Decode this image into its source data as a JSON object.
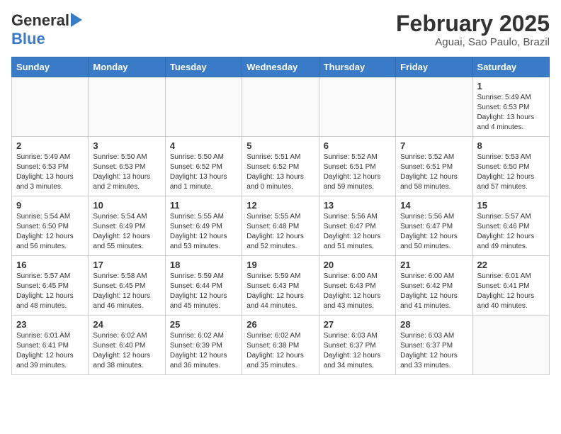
{
  "header": {
    "logo_general": "General",
    "logo_blue": "Blue",
    "month_title": "February 2025",
    "location": "Aguai, Sao Paulo, Brazil"
  },
  "weekdays": [
    "Sunday",
    "Monday",
    "Tuesday",
    "Wednesday",
    "Thursday",
    "Friday",
    "Saturday"
  ],
  "weeks": [
    [
      {
        "day": "",
        "info": ""
      },
      {
        "day": "",
        "info": ""
      },
      {
        "day": "",
        "info": ""
      },
      {
        "day": "",
        "info": ""
      },
      {
        "day": "",
        "info": ""
      },
      {
        "day": "",
        "info": ""
      },
      {
        "day": "1",
        "info": "Sunrise: 5:49 AM\nSunset: 6:53 PM\nDaylight: 13 hours\nand 4 minutes."
      }
    ],
    [
      {
        "day": "2",
        "info": "Sunrise: 5:49 AM\nSunset: 6:53 PM\nDaylight: 13 hours\nand 3 minutes."
      },
      {
        "day": "3",
        "info": "Sunrise: 5:50 AM\nSunset: 6:53 PM\nDaylight: 13 hours\nand 2 minutes."
      },
      {
        "day": "4",
        "info": "Sunrise: 5:50 AM\nSunset: 6:52 PM\nDaylight: 13 hours\nand 1 minute."
      },
      {
        "day": "5",
        "info": "Sunrise: 5:51 AM\nSunset: 6:52 PM\nDaylight: 13 hours\nand 0 minutes."
      },
      {
        "day": "6",
        "info": "Sunrise: 5:52 AM\nSunset: 6:51 PM\nDaylight: 12 hours\nand 59 minutes."
      },
      {
        "day": "7",
        "info": "Sunrise: 5:52 AM\nSunset: 6:51 PM\nDaylight: 12 hours\nand 58 minutes."
      },
      {
        "day": "8",
        "info": "Sunrise: 5:53 AM\nSunset: 6:50 PM\nDaylight: 12 hours\nand 57 minutes."
      }
    ],
    [
      {
        "day": "9",
        "info": "Sunrise: 5:54 AM\nSunset: 6:50 PM\nDaylight: 12 hours\nand 56 minutes."
      },
      {
        "day": "10",
        "info": "Sunrise: 5:54 AM\nSunset: 6:49 PM\nDaylight: 12 hours\nand 55 minutes."
      },
      {
        "day": "11",
        "info": "Sunrise: 5:55 AM\nSunset: 6:49 PM\nDaylight: 12 hours\nand 53 minutes."
      },
      {
        "day": "12",
        "info": "Sunrise: 5:55 AM\nSunset: 6:48 PM\nDaylight: 12 hours\nand 52 minutes."
      },
      {
        "day": "13",
        "info": "Sunrise: 5:56 AM\nSunset: 6:47 PM\nDaylight: 12 hours\nand 51 minutes."
      },
      {
        "day": "14",
        "info": "Sunrise: 5:56 AM\nSunset: 6:47 PM\nDaylight: 12 hours\nand 50 minutes."
      },
      {
        "day": "15",
        "info": "Sunrise: 5:57 AM\nSunset: 6:46 PM\nDaylight: 12 hours\nand 49 minutes."
      }
    ],
    [
      {
        "day": "16",
        "info": "Sunrise: 5:57 AM\nSunset: 6:45 PM\nDaylight: 12 hours\nand 48 minutes."
      },
      {
        "day": "17",
        "info": "Sunrise: 5:58 AM\nSunset: 6:45 PM\nDaylight: 12 hours\nand 46 minutes."
      },
      {
        "day": "18",
        "info": "Sunrise: 5:59 AM\nSunset: 6:44 PM\nDaylight: 12 hours\nand 45 minutes."
      },
      {
        "day": "19",
        "info": "Sunrise: 5:59 AM\nSunset: 6:43 PM\nDaylight: 12 hours\nand 44 minutes."
      },
      {
        "day": "20",
        "info": "Sunrise: 6:00 AM\nSunset: 6:43 PM\nDaylight: 12 hours\nand 43 minutes."
      },
      {
        "day": "21",
        "info": "Sunrise: 6:00 AM\nSunset: 6:42 PM\nDaylight: 12 hours\nand 41 minutes."
      },
      {
        "day": "22",
        "info": "Sunrise: 6:01 AM\nSunset: 6:41 PM\nDaylight: 12 hours\nand 40 minutes."
      }
    ],
    [
      {
        "day": "23",
        "info": "Sunrise: 6:01 AM\nSunset: 6:41 PM\nDaylight: 12 hours\nand 39 minutes."
      },
      {
        "day": "24",
        "info": "Sunrise: 6:02 AM\nSunset: 6:40 PM\nDaylight: 12 hours\nand 38 minutes."
      },
      {
        "day": "25",
        "info": "Sunrise: 6:02 AM\nSunset: 6:39 PM\nDaylight: 12 hours\nand 36 minutes."
      },
      {
        "day": "26",
        "info": "Sunrise: 6:02 AM\nSunset: 6:38 PM\nDaylight: 12 hours\nand 35 minutes."
      },
      {
        "day": "27",
        "info": "Sunrise: 6:03 AM\nSunset: 6:37 PM\nDaylight: 12 hours\nand 34 minutes."
      },
      {
        "day": "28",
        "info": "Sunrise: 6:03 AM\nSunset: 6:37 PM\nDaylight: 12 hours\nand 33 minutes."
      },
      {
        "day": "",
        "info": ""
      }
    ]
  ]
}
